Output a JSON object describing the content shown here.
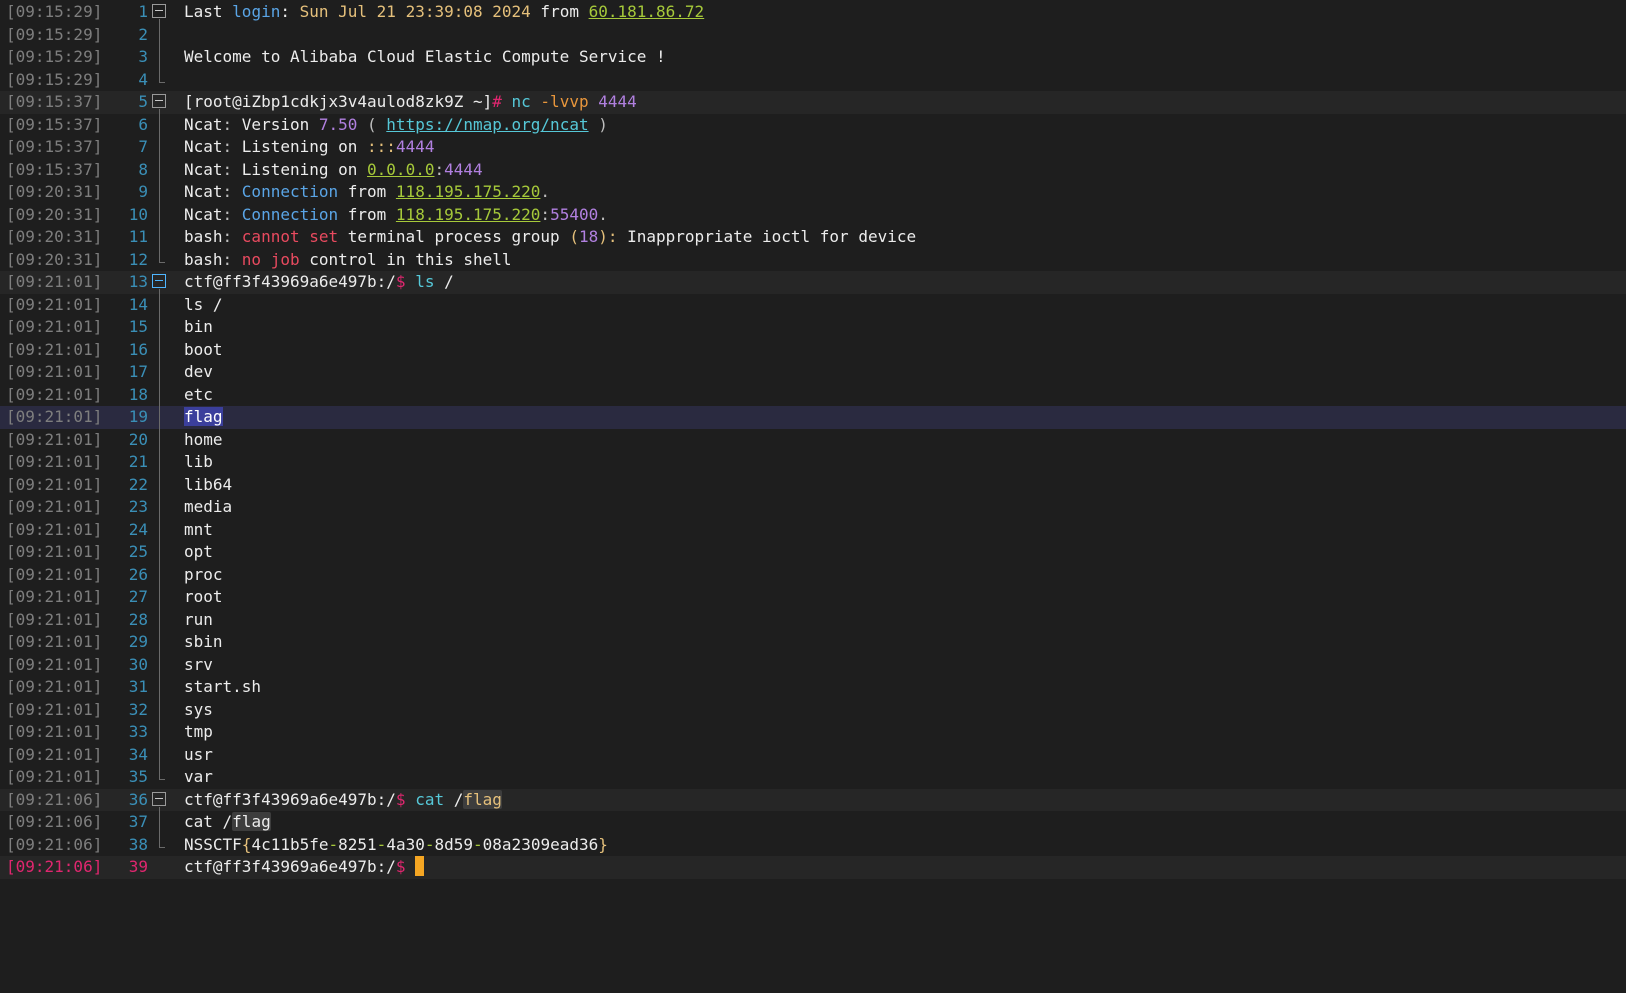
{
  "terminal": {
    "current_cursor_color": "#f5a623",
    "lines": [
      {
        "ts": "[09:15:29]",
        "n": "1",
        "fold": "box",
        "segs": [
          [
            "Last ",
            "c-white"
          ],
          [
            "login",
            "c-blue"
          ],
          [
            ": ",
            "c-white"
          ],
          [
            "Sun Jul 21 23:39:08 2024",
            "c-yellow"
          ],
          [
            " from ",
            "c-white"
          ],
          [
            "60.181.86.72",
            "c-green u"
          ]
        ]
      },
      {
        "ts": "[09:15:29]",
        "n": "2",
        "fold": "line",
        "segs": []
      },
      {
        "ts": "[09:15:29]",
        "n": "3",
        "fold": "line",
        "segs": [
          [
            "Welcome to Alibaba Cloud Elastic Compute Service !",
            "c-white"
          ]
        ]
      },
      {
        "ts": "[09:15:29]",
        "n": "4",
        "fold": "end",
        "segs": []
      },
      {
        "ts": "[09:15:37]",
        "n": "5",
        "fold": "box",
        "row": "active",
        "segs": [
          [
            "[root@iZbp1cdkjx3v4aulod8zk9Z ~]",
            "c-white"
          ],
          [
            "# ",
            "c-pink"
          ],
          [
            "nc ",
            "c-cyan"
          ],
          [
            "-lvvp ",
            "c-orange"
          ],
          [
            "4444",
            "c-purple"
          ]
        ]
      },
      {
        "ts": "[09:15:37]",
        "n": "6",
        "fold": "line",
        "segs": [
          [
            "Ncat",
            "c-white"
          ],
          [
            ": ",
            "c-gray"
          ],
          [
            "Version ",
            "c-white"
          ],
          [
            "7.50",
            "c-purple"
          ],
          [
            " ( ",
            "c-gray"
          ],
          [
            "https://nmap.org/ncat",
            "c-cyan u"
          ],
          [
            " )",
            "c-gray"
          ]
        ]
      },
      {
        "ts": "[09:15:37]",
        "n": "7",
        "fold": "line",
        "segs": [
          [
            "Ncat",
            "c-white"
          ],
          [
            ": ",
            "c-gray"
          ],
          [
            "Listening on ",
            "c-white"
          ],
          [
            ":::",
            "c-yellow"
          ],
          [
            "4444",
            "c-purple"
          ]
        ]
      },
      {
        "ts": "[09:15:37]",
        "n": "8",
        "fold": "line",
        "segs": [
          [
            "Ncat",
            "c-white"
          ],
          [
            ": ",
            "c-gray"
          ],
          [
            "Listening on ",
            "c-white"
          ],
          [
            "0.0.0.0",
            "c-green u"
          ],
          [
            ":",
            "c-gray"
          ],
          [
            "4444",
            "c-purple"
          ]
        ]
      },
      {
        "ts": "[09:20:31]",
        "n": "9",
        "fold": "line",
        "segs": [
          [
            "Ncat",
            "c-white"
          ],
          [
            ": ",
            "c-gray"
          ],
          [
            "Connection",
            "c-blue"
          ],
          [
            " from ",
            "c-white"
          ],
          [
            "118.195.175.220",
            "c-green u"
          ],
          [
            ".",
            "c-gray"
          ]
        ]
      },
      {
        "ts": "[09:20:31]",
        "n": "10",
        "fold": "line",
        "segs": [
          [
            "Ncat",
            "c-white"
          ],
          [
            ": ",
            "c-gray"
          ],
          [
            "Connection",
            "c-blue"
          ],
          [
            " from ",
            "c-white"
          ],
          [
            "118.195.175.220",
            "c-green u"
          ],
          [
            ":",
            "c-gray"
          ],
          [
            "55400",
            "c-purple"
          ],
          [
            ".",
            "c-gray"
          ]
        ]
      },
      {
        "ts": "[09:20:31]",
        "n": "11",
        "fold": "line",
        "segs": [
          [
            "bash",
            "c-white"
          ],
          [
            ": ",
            "c-gray"
          ],
          [
            "cannot set",
            "c-red"
          ],
          [
            " terminal process group ",
            "c-white"
          ],
          [
            "(",
            "c-yellow"
          ],
          [
            "18",
            "c-purple"
          ],
          [
            "): ",
            "c-yellow"
          ],
          [
            "Inappropriate ioctl for device",
            "c-white"
          ]
        ]
      },
      {
        "ts": "[09:20:31]",
        "n": "12",
        "fold": "end",
        "segs": [
          [
            "bash",
            "c-white"
          ],
          [
            ": ",
            "c-gray"
          ],
          [
            "no job",
            "c-red"
          ],
          [
            " control in this shell",
            "c-white"
          ]
        ]
      },
      {
        "ts": "[09:21:01]",
        "n": "13",
        "fold": "boxblue",
        "row": "active",
        "segs": [
          [
            "ctf@ff3f43969a6e497b:/",
            "c-white"
          ],
          [
            "$ ",
            "c-pink"
          ],
          [
            "ls ",
            "c-cyan"
          ],
          [
            "/",
            "c-white"
          ]
        ]
      },
      {
        "ts": "[09:21:01]",
        "n": "14",
        "fold": "line",
        "segs": [
          [
            "ls /",
            "c-white"
          ]
        ]
      },
      {
        "ts": "[09:21:01]",
        "n": "15",
        "fold": "line",
        "segs": [
          [
            "bin",
            "c-white"
          ]
        ]
      },
      {
        "ts": "[09:21:01]",
        "n": "16",
        "fold": "line",
        "segs": [
          [
            "boot",
            "c-white"
          ]
        ]
      },
      {
        "ts": "[09:21:01]",
        "n": "17",
        "fold": "line",
        "segs": [
          [
            "dev",
            "c-white"
          ]
        ]
      },
      {
        "ts": "[09:21:01]",
        "n": "18",
        "fold": "line",
        "segs": [
          [
            "etc",
            "c-white"
          ]
        ]
      },
      {
        "ts": "[09:21:01]",
        "n": "19",
        "fold": "line",
        "row": "highlight",
        "segs": [
          [
            "flag",
            "sel-flag"
          ]
        ]
      },
      {
        "ts": "[09:21:01]",
        "n": "20",
        "fold": "line",
        "segs": [
          [
            "home",
            "c-white"
          ]
        ]
      },
      {
        "ts": "[09:21:01]",
        "n": "21",
        "fold": "line",
        "segs": [
          [
            "lib",
            "c-white"
          ]
        ]
      },
      {
        "ts": "[09:21:01]",
        "n": "22",
        "fold": "line",
        "segs": [
          [
            "lib64",
            "c-white"
          ]
        ]
      },
      {
        "ts": "[09:21:01]",
        "n": "23",
        "fold": "line",
        "segs": [
          [
            "media",
            "c-white"
          ]
        ]
      },
      {
        "ts": "[09:21:01]",
        "n": "24",
        "fold": "line",
        "segs": [
          [
            "mnt",
            "c-white"
          ]
        ]
      },
      {
        "ts": "[09:21:01]",
        "n": "25",
        "fold": "line",
        "segs": [
          [
            "opt",
            "c-white"
          ]
        ]
      },
      {
        "ts": "[09:21:01]",
        "n": "26",
        "fold": "line",
        "segs": [
          [
            "proc",
            "c-white"
          ]
        ]
      },
      {
        "ts": "[09:21:01]",
        "n": "27",
        "fold": "line",
        "segs": [
          [
            "root",
            "c-white"
          ]
        ]
      },
      {
        "ts": "[09:21:01]",
        "n": "28",
        "fold": "line",
        "segs": [
          [
            "run",
            "c-white"
          ]
        ]
      },
      {
        "ts": "[09:21:01]",
        "n": "29",
        "fold": "line",
        "segs": [
          [
            "sbin",
            "c-white"
          ]
        ]
      },
      {
        "ts": "[09:21:01]",
        "n": "30",
        "fold": "line",
        "segs": [
          [
            "srv",
            "c-white"
          ]
        ]
      },
      {
        "ts": "[09:21:01]",
        "n": "31",
        "fold": "line",
        "segs": [
          [
            "start.sh",
            "c-white"
          ]
        ]
      },
      {
        "ts": "[09:21:01]",
        "n": "32",
        "fold": "line",
        "segs": [
          [
            "sys",
            "c-white"
          ]
        ]
      },
      {
        "ts": "[09:21:01]",
        "n": "33",
        "fold": "line",
        "segs": [
          [
            "tmp",
            "c-white"
          ]
        ]
      },
      {
        "ts": "[09:21:01]",
        "n": "34",
        "fold": "line",
        "segs": [
          [
            "usr",
            "c-white"
          ]
        ]
      },
      {
        "ts": "[09:21:01]",
        "n": "35",
        "fold": "end",
        "segs": [
          [
            "var",
            "c-white"
          ]
        ]
      },
      {
        "ts": "[09:21:06]",
        "n": "36",
        "fold": "box",
        "row": "active",
        "segs": [
          [
            "ctf@ff3f43969a6e497b:/",
            "c-white"
          ],
          [
            "$ ",
            "c-pink"
          ],
          [
            "cat ",
            "c-cyan"
          ],
          [
            "/",
            "c-white"
          ],
          [
            "flag",
            "c-yellow match-flag"
          ]
        ]
      },
      {
        "ts": "[09:21:06]",
        "n": "37",
        "fold": "line",
        "segs": [
          [
            "cat /",
            "c-white"
          ],
          [
            "flag",
            "c-white match-flag"
          ]
        ]
      },
      {
        "ts": "[09:21:06]",
        "n": "38",
        "fold": "end",
        "segs": [
          [
            "NSSCTF",
            "c-white"
          ],
          [
            "{",
            "c-yellow"
          ],
          [
            "4c11b5fe",
            "c-white"
          ],
          [
            "-",
            "c-green"
          ],
          [
            "8251",
            "c-white"
          ],
          [
            "-",
            "c-green"
          ],
          [
            "4a30",
            "c-white"
          ],
          [
            "-",
            "c-green"
          ],
          [
            "8d59",
            "c-white"
          ],
          [
            "-",
            "c-green"
          ],
          [
            "08a2309ead36",
            "c-white"
          ],
          [
            "}",
            "c-yellow"
          ]
        ]
      },
      {
        "ts": "[09:21:06]",
        "n": "39",
        "fold": "none",
        "row": "current",
        "cursor": true,
        "segs": [
          [
            "ctf@ff3f43969a6e497b:/",
            "c-white"
          ],
          [
            "$ ",
            "c-pink"
          ]
        ]
      }
    ]
  }
}
